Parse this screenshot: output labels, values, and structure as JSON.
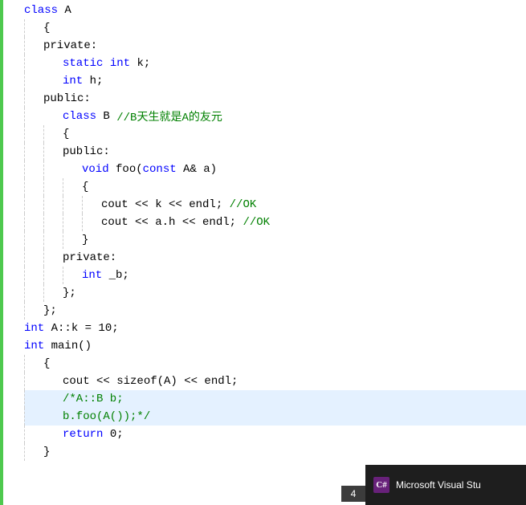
{
  "editor": {
    "background": "#ffffff",
    "lines": [
      {
        "id": 1,
        "indent": 0,
        "hasFold": true,
        "foldOpen": true,
        "content": "class A",
        "tokens": [
          {
            "t": "kw",
            "v": "class"
          },
          {
            "t": "plain",
            "v": " A"
          }
        ]
      },
      {
        "id": 2,
        "indent": 1,
        "content": "{",
        "tokens": [
          {
            "t": "plain",
            "v": "{"
          }
        ]
      },
      {
        "id": 3,
        "indent": 1,
        "content": "private:",
        "tokens": [
          {
            "t": "plain",
            "v": "private:"
          }
        ]
      },
      {
        "id": 4,
        "indent": 2,
        "content": "static int k;",
        "tokens": [
          {
            "t": "kw",
            "v": "static"
          },
          {
            "t": "plain",
            "v": " "
          },
          {
            "t": "kw",
            "v": "int"
          },
          {
            "t": "plain",
            "v": " k;"
          }
        ]
      },
      {
        "id": 5,
        "indent": 2,
        "content": "int h;",
        "tokens": [
          {
            "t": "kw",
            "v": "int"
          },
          {
            "t": "plain",
            "v": " h;"
          }
        ]
      },
      {
        "id": 6,
        "indent": 1,
        "content": "public:",
        "tokens": [
          {
            "t": "plain",
            "v": "public:"
          }
        ]
      },
      {
        "id": 7,
        "indent": 2,
        "hasFold": true,
        "foldOpen": true,
        "content": "class B //B天生就是A的友元",
        "tokens": [
          {
            "t": "kw",
            "v": "class"
          },
          {
            "t": "plain",
            "v": " B "
          },
          {
            "t": "cm",
            "v": "//B天生就是A的友元"
          }
        ]
      },
      {
        "id": 8,
        "indent": 2,
        "content": "{",
        "tokens": [
          {
            "t": "plain",
            "v": "{"
          }
        ]
      },
      {
        "id": 9,
        "indent": 2,
        "content": "public:",
        "tokens": [
          {
            "t": "plain",
            "v": "public:"
          }
        ]
      },
      {
        "id": 10,
        "indent": 3,
        "hasFold": true,
        "foldOpen": true,
        "content": "void foo(const A& a)",
        "tokens": [
          {
            "t": "kw",
            "v": "void"
          },
          {
            "t": "plain",
            "v": " foo("
          },
          {
            "t": "kw",
            "v": "const"
          },
          {
            "t": "plain",
            "v": " A& a)"
          }
        ]
      },
      {
        "id": 11,
        "indent": 3,
        "content": "{",
        "tokens": [
          {
            "t": "plain",
            "v": "{"
          }
        ]
      },
      {
        "id": 12,
        "indent": 4,
        "content": "cout << k << endl; //OK",
        "tokens": [
          {
            "t": "plain",
            "v": "cout << k << endl; "
          },
          {
            "t": "cm",
            "v": "//OK"
          }
        ]
      },
      {
        "id": 13,
        "indent": 4,
        "content": "cout << a.h << endl; //OK",
        "tokens": [
          {
            "t": "plain",
            "v": "cout << a.h << endl; "
          },
          {
            "t": "cm",
            "v": "//OK"
          }
        ]
      },
      {
        "id": 14,
        "indent": 3,
        "content": "}",
        "tokens": [
          {
            "t": "plain",
            "v": "}"
          }
        ]
      },
      {
        "id": 15,
        "indent": 2,
        "content": "private:",
        "tokens": [
          {
            "t": "plain",
            "v": "private:"
          }
        ]
      },
      {
        "id": 16,
        "indent": 3,
        "content": "int _b;",
        "tokens": [
          {
            "t": "kw",
            "v": "int"
          },
          {
            "t": "plain",
            "v": " _b;"
          }
        ]
      },
      {
        "id": 17,
        "indent": 2,
        "content": "};",
        "tokens": [
          {
            "t": "plain",
            "v": "};"
          }
        ]
      },
      {
        "id": 18,
        "indent": 1,
        "content": "};",
        "tokens": [
          {
            "t": "plain",
            "v": "};"
          }
        ]
      },
      {
        "id": 19,
        "indent": 0,
        "content": "int A::k = 10;",
        "tokens": [
          {
            "t": "kw",
            "v": "int"
          },
          {
            "t": "plain",
            "v": " A::k = 10;"
          }
        ]
      },
      {
        "id": 20,
        "indent": 0,
        "hasFold": true,
        "foldOpen": true,
        "content": "int main()",
        "tokens": [
          {
            "t": "kw",
            "v": "int"
          },
          {
            "t": "plain",
            "v": " main()"
          }
        ]
      },
      {
        "id": 21,
        "indent": 1,
        "content": "{",
        "tokens": [
          {
            "t": "plain",
            "v": "{"
          }
        ]
      },
      {
        "id": 22,
        "indent": 2,
        "content": "cout << sizeof(A) << endl;",
        "tokens": [
          {
            "t": "plain",
            "v": "cout << sizeof(A) << endl;"
          }
        ]
      },
      {
        "id": 23,
        "indent": 2,
        "selected": true,
        "content": "/*A::B b;",
        "tokens": [
          {
            "t": "cm",
            "v": "/*A::B b;"
          }
        ]
      },
      {
        "id": 24,
        "indent": 2,
        "selected": true,
        "content": "b.foo(A());*/",
        "tokens": [
          {
            "t": "cm",
            "v": "b.foo(A());*/"
          }
        ]
      },
      {
        "id": 25,
        "indent": 2,
        "content": "return 0;",
        "tokens": [
          {
            "t": "kw",
            "v": "return"
          },
          {
            "t": "plain",
            "v": " 0;"
          }
        ]
      },
      {
        "id": 26,
        "indent": 1,
        "content": "}",
        "tokens": [
          {
            "t": "plain",
            "v": "}"
          }
        ]
      }
    ]
  },
  "taskbar": {
    "vs_icon_text": "C#",
    "vs_label": "Microsoft Visual Stu",
    "page_number": "4"
  }
}
